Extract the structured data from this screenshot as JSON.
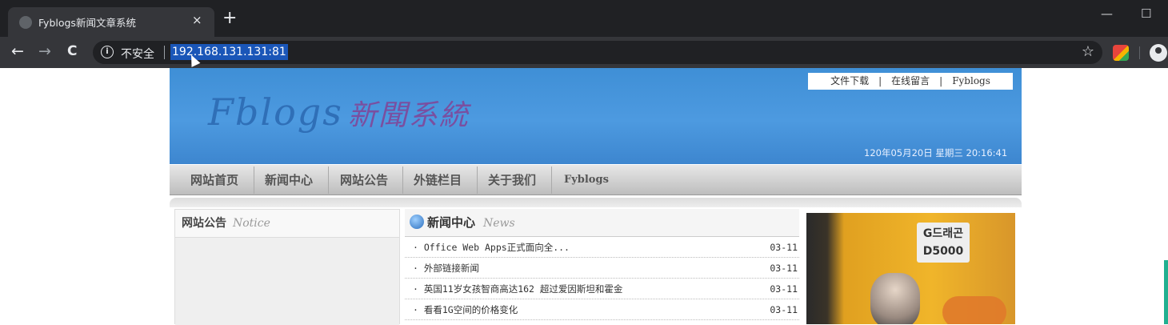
{
  "browser": {
    "tab_title": "Fyblogs新闻文章系统",
    "tab_close": "×",
    "new_tab": "+",
    "minimize": "—",
    "maximize": "☐",
    "back": "←",
    "forward": "→",
    "reload": "C",
    "info": "i",
    "insecure_label": "不安全",
    "url": "192.168.131.131:81",
    "bookmark": "☆"
  },
  "site": {
    "logo_en": "Fblogs",
    "logo_cn": "新聞系統",
    "top_links": [
      "文件下载",
      "在线留言",
      "Fyblogs"
    ],
    "top_link_sep": "|",
    "datetime": "120年05月20日 星期三 20:16:41",
    "nav": [
      "网站首页",
      "新闻中心",
      "网站公告",
      "外链栏目",
      "关于我们",
      "Fyblogs"
    ],
    "notice": {
      "title": "网站公告",
      "title_en": "Notice"
    },
    "news": {
      "title": "新闻中心",
      "title_en": "News",
      "items": [
        {
          "title": "· Office Web Apps正式面向全...",
          "date": "03-11"
        },
        {
          "title": "· 外部链接新闻",
          "date": "03-11"
        },
        {
          "title": "· 英国11岁女孩智商高达162 超过爱因斯坦和霍金",
          "date": "03-11"
        },
        {
          "title": "· 看看1G空间的价格变化",
          "date": "03-11"
        }
      ]
    },
    "photo_poster": "G드래곤\nD5000"
  }
}
